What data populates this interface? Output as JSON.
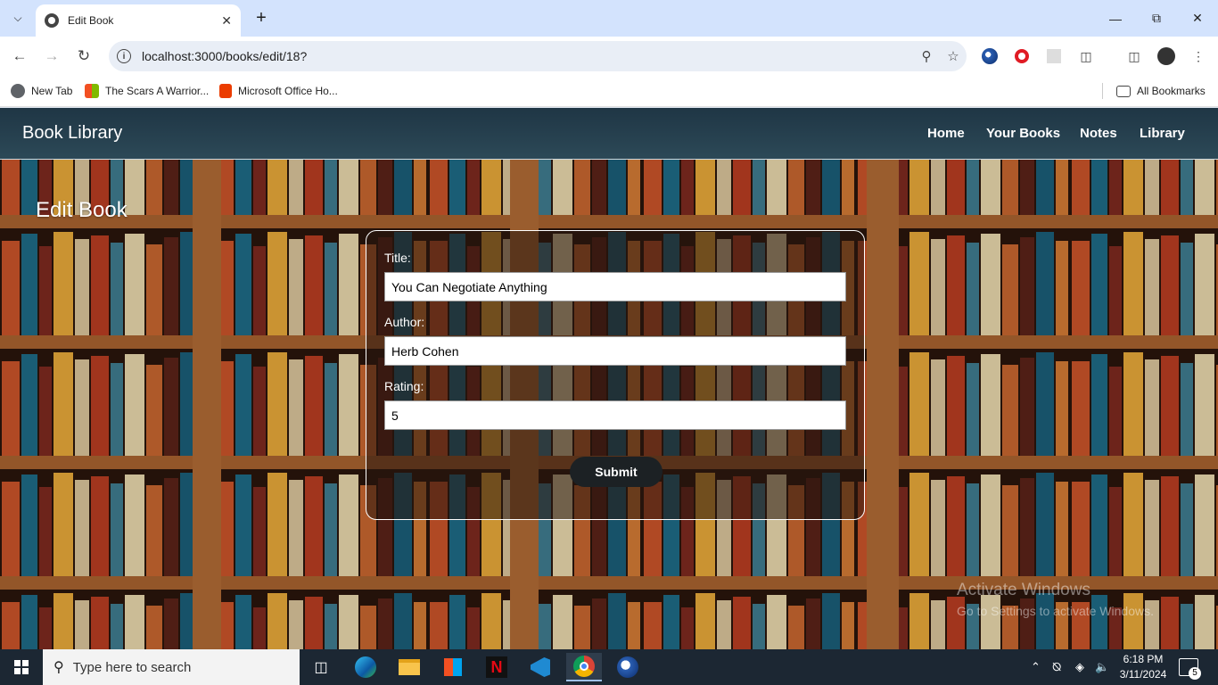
{
  "browser": {
    "tab_title": "Edit Book",
    "url": "localhost:3000/books/edit/18?",
    "bookmarks": [
      {
        "label": "New Tab",
        "color": "#5f6368"
      },
      {
        "label": "The Scars A Warrior...",
        "color": "#f25022"
      },
      {
        "label": "Microsoft Office Ho...",
        "color": "#eb3c00"
      }
    ],
    "all_bookmarks": "All Bookmarks"
  },
  "site": {
    "brand": "Book Library",
    "nav": [
      "Home",
      "Your Books",
      "Notes",
      "Library"
    ]
  },
  "page": {
    "heading": "Edit Book",
    "form": {
      "title_label": "Title:",
      "title_value": "You Can Negotiate Anything",
      "author_label": "Author:",
      "author_value": "Herb Cohen",
      "rating_label": "Rating:",
      "rating_value": "5",
      "submit_label": "Submit"
    }
  },
  "watermark": {
    "line1": "Activate Windows",
    "line2": "Go to Settings to activate Windows."
  },
  "taskbar": {
    "search_placeholder": "Type here to search",
    "time": "6:18 PM",
    "date": "3/11/2024",
    "notifications": "5"
  },
  "colors": {
    "navbar": "#2c4957",
    "submit": "#1c2124",
    "tabbar": "#d3e3fd"
  }
}
